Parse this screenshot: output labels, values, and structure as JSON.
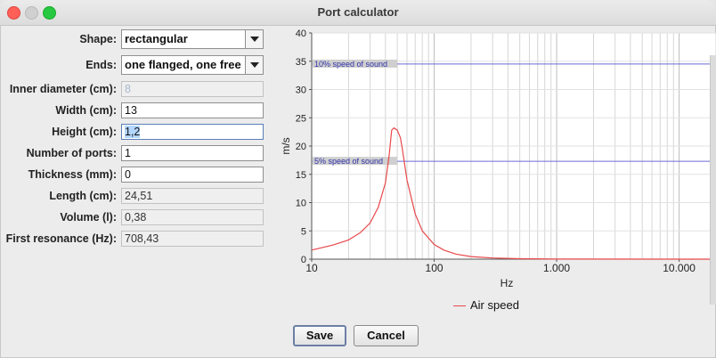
{
  "window": {
    "title": "Port calculator"
  },
  "form": {
    "shape": {
      "label": "Shape:",
      "value": "rectangular"
    },
    "ends": {
      "label": "Ends:",
      "value": "one flanged, one free"
    },
    "inner_diameter": {
      "label": "Inner diameter (cm):",
      "placeholder": "8"
    },
    "width": {
      "label": "Width (cm):",
      "value": "13"
    },
    "height": {
      "label": "Height (cm):",
      "value": "1,2"
    },
    "number_of_ports": {
      "label": "Number of ports:",
      "value": "1"
    },
    "thickness": {
      "label": "Thickness (mm):",
      "value": "0"
    },
    "length": {
      "label": "Length (cm):",
      "value": "24,51"
    },
    "volume": {
      "label": "Volume (l):",
      "value": "0,38"
    },
    "first_resonance": {
      "label": "First resonance (Hz):",
      "value": "708,43"
    }
  },
  "buttons": {
    "save": "Save",
    "cancel": "Cancel"
  },
  "chart_data": {
    "type": "line",
    "xlabel": "Hz",
    "ylabel": "m/s",
    "x_scale": "log",
    "xlim": [
      10,
      20000
    ],
    "ylim": [
      0,
      40
    ],
    "x_tick_labels": [
      "10",
      "100",
      "1.000",
      "10.000"
    ],
    "y_tick_labels": [
      "0",
      "5",
      "10",
      "15",
      "20",
      "25",
      "30",
      "35",
      "40"
    ],
    "grid": true,
    "series": [
      {
        "name": "Air speed",
        "color": "#e8484b",
        "x": [
          10,
          15,
          20,
          25,
          30,
          35,
          40,
          43,
          45,
          47,
          50,
          53,
          55,
          60,
          70,
          80,
          100,
          120,
          150,
          200,
          300,
          500,
          1000,
          20000
        ],
        "y": [
          1.6,
          2.5,
          3.4,
          4.7,
          6.4,
          9.2,
          13.5,
          18.5,
          22.8,
          23.2,
          22.8,
          21.5,
          19.5,
          14.0,
          8.0,
          5.0,
          2.6,
          1.6,
          0.9,
          0.45,
          0.2,
          0.08,
          0.02,
          0
        ]
      }
    ],
    "reference_lines": [
      {
        "label": "10% speed of sound",
        "y": 34.5
      },
      {
        "label": "5% speed of sound",
        "y": 17.3
      }
    ]
  }
}
